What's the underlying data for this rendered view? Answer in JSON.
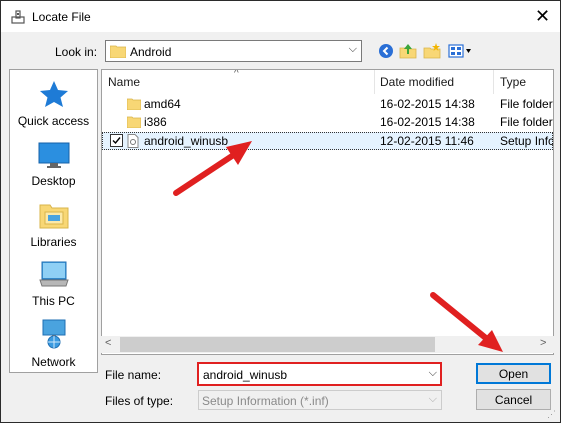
{
  "window": {
    "title": "Locate File"
  },
  "toolbar": {
    "look_in_label": "Look in:",
    "look_in_value": "Android",
    "back_icon": "back-arrow-icon",
    "up_icon": "up-folder-icon",
    "new_folder_icon": "new-folder-icon",
    "view_menu_icon": "view-menu-icon"
  },
  "places": [
    {
      "label": "Quick access",
      "icon": "star-icon"
    },
    {
      "label": "Desktop",
      "icon": "desktop-icon"
    },
    {
      "label": "Libraries",
      "icon": "libraries-icon"
    },
    {
      "label": "This PC",
      "icon": "computer-icon"
    },
    {
      "label": "Network",
      "icon": "network-icon"
    }
  ],
  "list": {
    "columns": [
      "Name",
      "Date modified",
      "Type"
    ],
    "rows": [
      {
        "name": "amd64",
        "date": "16-02-2015 14:38",
        "type": "File folder",
        "icon": "folder-icon",
        "selected": false
      },
      {
        "name": "i386",
        "date": "16-02-2015 14:38",
        "type": "File folder",
        "icon": "folder-icon",
        "selected": false
      },
      {
        "name": "android_winusb",
        "date": "12-02-2015 11:46",
        "type": "Setup Infc",
        "icon": "setup-file-icon",
        "selected": true
      }
    ]
  },
  "footer": {
    "file_name_label": "File name:",
    "file_name_value": "android_winusb",
    "file_type_label": "Files of type:",
    "file_type_value": "Setup Information (*.inf)",
    "open_label": "Open",
    "cancel_label": "Cancel"
  },
  "colors": {
    "highlight": "#e02020",
    "selection": "#e5f3ff",
    "accent": "#0078d7"
  }
}
